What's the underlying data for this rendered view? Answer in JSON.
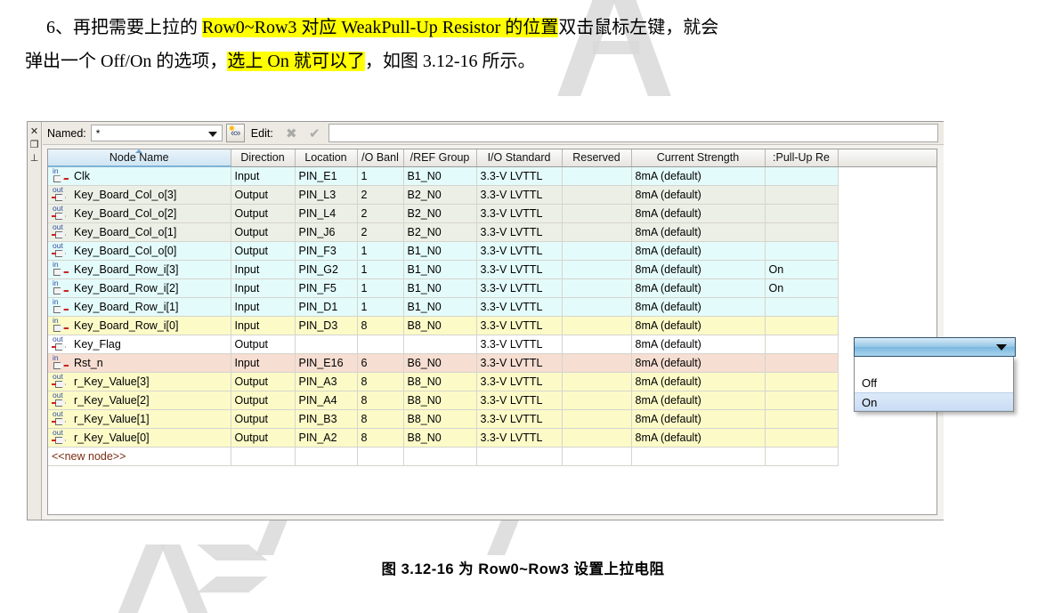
{
  "document": {
    "paragraph_line1_prefix": "6、再把需要上拉的 ",
    "paragraph_line1_highlight": "Row0~Row3 对应 WeakPull-Up Resistor 的位置",
    "paragraph_line1_suffix": "双击鼠标左键，就会",
    "paragraph_line2_prefix": "弹出一个 Off/On 的选项，",
    "paragraph_line2_highlight": "选上 On 就可以了",
    "paragraph_line2_suffix": "，如图 3.12-16 所示。",
    "caption": "图 3.12-16  为 Row0~Row3 设置上拉电阻"
  },
  "panel": {
    "vtoolbar": [
      {
        "name": "close-icon",
        "glyph": "✕"
      },
      {
        "name": "restore-icon",
        "glyph": "❐"
      },
      {
        "name": "pin-icon",
        "glyph": "⊥"
      }
    ],
    "toolbar": {
      "named_label": "Named:",
      "named_value": "*",
      "filter_button_label": "«»",
      "edit_label": "Edit:",
      "cancel_glyph": "✖",
      "accept_glyph": "✔",
      "edit_value": ""
    },
    "columns": [
      "Node Name",
      "Direction",
      "Location",
      "/O Banl",
      "/REF Group",
      "I/O Standard",
      "Reserved",
      "Current Strength",
      ":Pull-Up Re",
      ""
    ],
    "rows": [
      {
        "icon": "in",
        "name": "Clk",
        "direction": "Input",
        "location": "PIN_E1",
        "bank": "1",
        "vref": "B1_N0",
        "standard": "3.3-V LVTTL",
        "reserved": "",
        "strength": "8mA (default)",
        "pullup": "",
        "tint": "r-cyan"
      },
      {
        "icon": "out",
        "name": "Key_Board_Col_o[3]",
        "direction": "Output",
        "location": "PIN_L3",
        "bank": "2",
        "vref": "B2_N0",
        "standard": "3.3-V LVTTL",
        "reserved": "",
        "strength": "8mA (default)",
        "pullup": "",
        "tint": "r-gray"
      },
      {
        "icon": "out",
        "name": "Key_Board_Col_o[2]",
        "direction": "Output",
        "location": "PIN_L4",
        "bank": "2",
        "vref": "B2_N0",
        "standard": "3.3-V LVTTL",
        "reserved": "",
        "strength": "8mA (default)",
        "pullup": "",
        "tint": "r-gray"
      },
      {
        "icon": "out",
        "name": "Key_Board_Col_o[1]",
        "direction": "Output",
        "location": "PIN_J6",
        "bank": "2",
        "vref": "B2_N0",
        "standard": "3.3-V LVTTL",
        "reserved": "",
        "strength": "8mA (default)",
        "pullup": "",
        "tint": "r-gray"
      },
      {
        "icon": "out",
        "name": "Key_Board_Col_o[0]",
        "direction": "Output",
        "location": "PIN_F3",
        "bank": "1",
        "vref": "B1_N0",
        "standard": "3.3-V LVTTL",
        "reserved": "",
        "strength": "8mA (default)",
        "pullup": "",
        "tint": "r-cyan"
      },
      {
        "icon": "in",
        "name": "Key_Board_Row_i[3]",
        "direction": "Input",
        "location": "PIN_G2",
        "bank": "1",
        "vref": "B1_N0",
        "standard": "3.3-V LVTTL",
        "reserved": "",
        "strength": "8mA (default)",
        "pullup": "On",
        "tint": "r-cyan"
      },
      {
        "icon": "in",
        "name": "Key_Board_Row_i[2]",
        "direction": "Input",
        "location": "PIN_F5",
        "bank": "1",
        "vref": "B1_N0",
        "standard": "3.3-V LVTTL",
        "reserved": "",
        "strength": "8mA (default)",
        "pullup": "On",
        "tint": "r-cyan"
      },
      {
        "icon": "in",
        "name": "Key_Board_Row_i[1]",
        "direction": "Input",
        "location": "PIN_D1",
        "bank": "1",
        "vref": "B1_N0",
        "standard": "3.3-V LVTTL",
        "reserved": "",
        "strength": "8mA (default)",
        "pullup": "",
        "tint": "r-cyan"
      },
      {
        "icon": "in",
        "name": "Key_Board_Row_i[0]",
        "direction": "Input",
        "location": "PIN_D3",
        "bank": "8",
        "vref": "B8_N0",
        "standard": "3.3-V LVTTL",
        "reserved": "",
        "strength": "8mA (default)",
        "pullup": "",
        "tint": "r-yellow"
      },
      {
        "icon": "out",
        "name": "Key_Flag",
        "direction": "Output",
        "location": "",
        "bank": "",
        "vref": "",
        "standard": "3.3-V LVTTL",
        "reserved": "",
        "strength": "8mA (default)",
        "pullup": "",
        "tint": "r-white"
      },
      {
        "icon": "in",
        "name": "Rst_n",
        "direction": "Input",
        "location": "PIN_E16",
        "bank": "6",
        "vref": "B6_N0",
        "standard": "3.3-V LVTTL",
        "reserved": "",
        "strength": "8mA (default)",
        "pullup": "",
        "tint": "r-peach"
      },
      {
        "icon": "out",
        "name": "r_Key_Value[3]",
        "direction": "Output",
        "location": "PIN_A3",
        "bank": "8",
        "vref": "B8_N0",
        "standard": "3.3-V LVTTL",
        "reserved": "",
        "strength": "8mA (default)",
        "pullup": "",
        "tint": "r-yellow"
      },
      {
        "icon": "out",
        "name": "r_Key_Value[2]",
        "direction": "Output",
        "location": "PIN_A4",
        "bank": "8",
        "vref": "B8_N0",
        "standard": "3.3-V LVTTL",
        "reserved": "",
        "strength": "8mA (default)",
        "pullup": "",
        "tint": "r-yellow"
      },
      {
        "icon": "out",
        "name": "r_Key_Value[1]",
        "direction": "Output",
        "location": "PIN_B3",
        "bank": "8",
        "vref": "B8_N0",
        "standard": "3.3-V LVTTL",
        "reserved": "",
        "strength": "8mA (default)",
        "pullup": "",
        "tint": "r-yellow"
      },
      {
        "icon": "out",
        "name": "r_Key_Value[0]",
        "direction": "Output",
        "location": "PIN_A2",
        "bank": "8",
        "vref": "B8_N0",
        "standard": "3.3-V LVTTL",
        "reserved": "",
        "strength": "8mA (default)",
        "pullup": "",
        "tint": "r-yellow"
      }
    ],
    "new_node_row": "<<new node>>",
    "dropdown": {
      "value": "",
      "options": [
        "Off",
        "On"
      ],
      "selected": "On"
    }
  },
  "colors": {
    "highlight": "#ffff00",
    "row_cyan": "#e4fbfb",
    "row_gray": "#ecefe6",
    "row_yellow": "#fcfbc8",
    "row_peach": "#f6ded2",
    "dropdown_accent": "#7bb8df"
  }
}
